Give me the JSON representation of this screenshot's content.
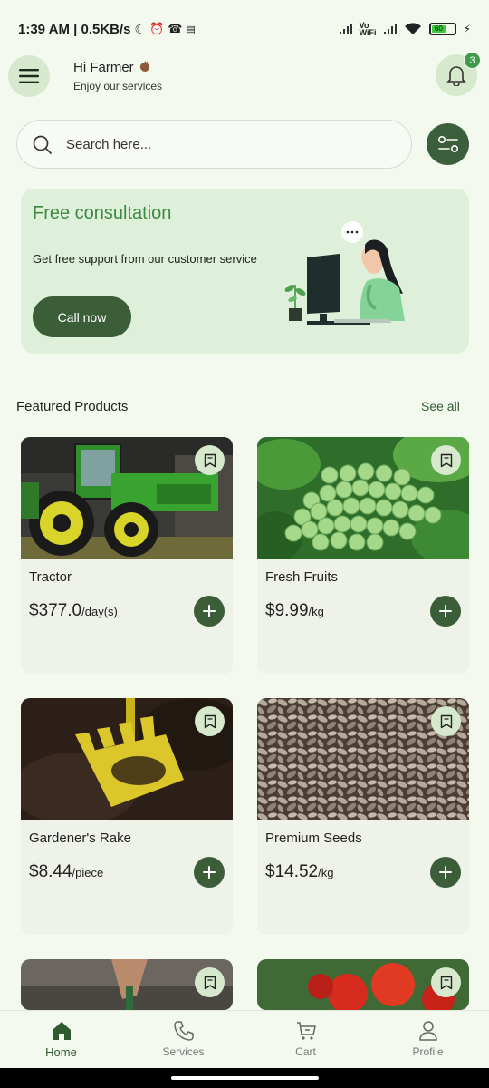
{
  "status_bar": {
    "time_speed": "1:39 AM | 0.5KB/s",
    "vo_wifi_top": "Vo",
    "vo_wifi_bottom": "WiFi",
    "battery": "60"
  },
  "header": {
    "greeting": "Hi Farmer",
    "subtitle": "Enjoy our services",
    "notification_count": "3"
  },
  "search": {
    "placeholder": "Search here..."
  },
  "banner": {
    "title": "Free consultation",
    "text": "Get free support from our customer service",
    "button_label": "Call now"
  },
  "featured": {
    "title": "Featured Products",
    "see_all": "See all"
  },
  "products": [
    {
      "name": "Tractor",
      "price": "$377.0",
      "unit": "/day(s)"
    },
    {
      "name": "Fresh Fruits",
      "price": "$9.99",
      "unit": "/kg"
    },
    {
      "name": "Gardener's Rake",
      "price": "$8.44",
      "unit": "/piece"
    },
    {
      "name": "Premium Seeds",
      "price": "$14.52",
      "unit": "/kg"
    }
  ],
  "nav": {
    "items": [
      {
        "label": "Home",
        "icon": "home-icon"
      },
      {
        "label": "Services",
        "icon": "phone-icon"
      },
      {
        "label": "Cart",
        "icon": "cart-icon"
      },
      {
        "label": "Profile",
        "icon": "profile-icon"
      }
    ]
  },
  "colors": {
    "accent": "#3b5e38",
    "background": "#f4f9f0",
    "banner": "#dff0da",
    "icon_bg": "#d6e9cd"
  }
}
